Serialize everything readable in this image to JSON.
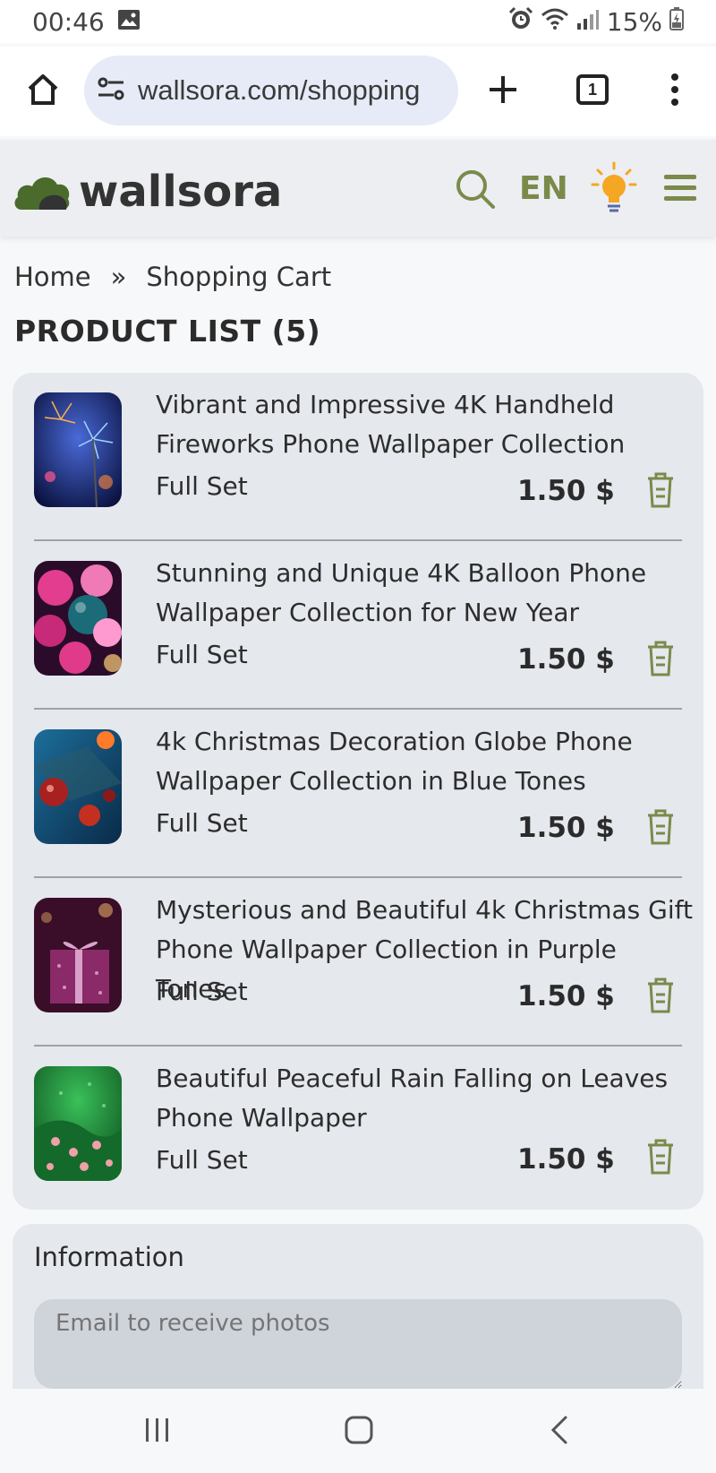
{
  "status_bar": {
    "time": "00:46",
    "battery": "15%",
    "icons": [
      "image-icon",
      "alarm-icon",
      "wifi-icon",
      "signal-icon",
      "battery-icon"
    ]
  },
  "browser": {
    "url": "wallsora.com/shopping",
    "tab_count": "1",
    "icons": [
      "home-icon",
      "site-settings-icon",
      "plus-icon",
      "tabs-icon",
      "more-vert-icon"
    ]
  },
  "header": {
    "logo_text": "wallsora",
    "language": "EN",
    "icons": [
      "search-icon",
      "lightbulb-icon",
      "menu-icon"
    ],
    "colors": {
      "brand_green": "#4f6b2e",
      "accent_olive": "#7a8a4a",
      "bulb_orange": "#f5a623"
    }
  },
  "breadcrumb": {
    "home": "Home",
    "separator": "»",
    "current": "Shopping Cart"
  },
  "product_list": {
    "title": "PRODUCT LIST (5)",
    "items": [
      {
        "title": "Vibrant and Impressive 4K Handheld Fireworks Phone Wallpaper Collection",
        "variant": "Full Set",
        "price": "1.50 $"
      },
      {
        "title": "Stunning and Unique 4K Balloon Phone Wallpaper Collection for New Year",
        "variant": "Full Set",
        "price": "1.50 $"
      },
      {
        "title": "4k Christmas Decoration Globe Phone Wallpaper Collection in Blue Tones",
        "variant": "Full Set",
        "price": "1.50 $"
      },
      {
        "title": "Mysterious and Beautiful 4k Christmas Gift Phone Wallpaper Collection in Purple Tones",
        "variant": "Full Set",
        "price": "1.50 $"
      },
      {
        "title": "Beautiful Peaceful Rain Falling on Leaves Phone Wallpaper",
        "variant": "Full Set",
        "price": "1.50 $"
      }
    ]
  },
  "information": {
    "title": "Information",
    "email_placeholder": "Email to receive photos"
  }
}
